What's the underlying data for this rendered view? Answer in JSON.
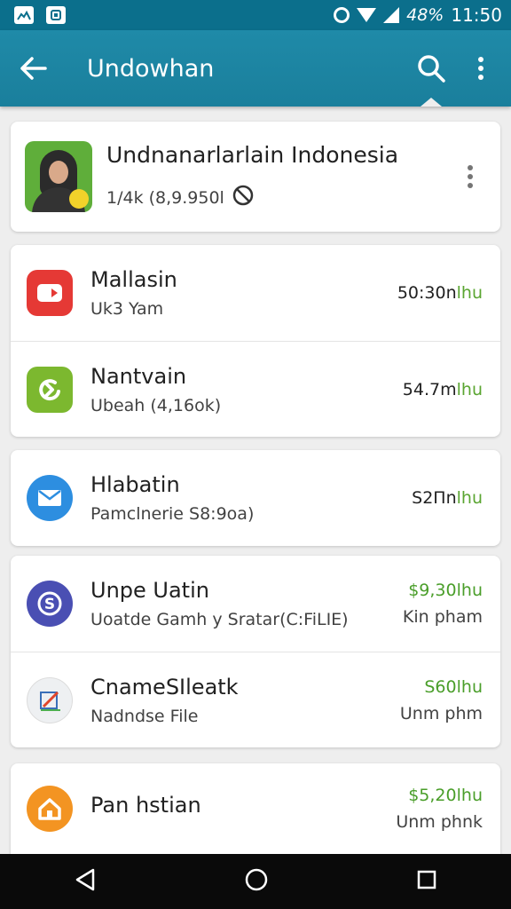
{
  "status_bar": {
    "battery_text": "48%",
    "time": "11:50",
    "icons": [
      "gallery-icon",
      "app-notification-icon",
      "alarm-icon",
      "wifi-icon",
      "signal-icon"
    ]
  },
  "app_bar": {
    "title": "Undowhan",
    "back_icon": "arrow-back-icon",
    "search_icon": "search-icon",
    "more_icon": "more-vert-icon",
    "color": "#1f8aa8"
  },
  "header_card": {
    "title": "Undnanarlarlain Indonesia",
    "stats": "1/4k  (8,9.950l",
    "stats_icon": "no-entry-icon"
  },
  "groups": [
    {
      "items": [
        {
          "name": "Mallasin",
          "subtitle": "Uk3 Yam",
          "price": "50:30n",
          "unit": "lhu",
          "icon": "video-icon",
          "icon_color": "#e53935"
        },
        {
          "name": "Nantvain",
          "subtitle": "Ubeah (4,16ok)",
          "price": "54.7m",
          "unit": "lhu",
          "icon": "refresh-arrow-icon",
          "icon_color": "#7cb82f"
        }
      ]
    },
    {
      "items": [
        {
          "name": "Hlabatin",
          "subtitle": "Pamclnerie S8:9oa)",
          "price": "S2Πn",
          "unit": "lhu",
          "icon": "mail-icon",
          "icon_color": "#2d8ee0"
        }
      ]
    },
    {
      "items": [
        {
          "name": "Unpe Uatin",
          "subtitle": "Uoatde Gamh y Sratar(C:FiLIE)",
          "price": "$9,30",
          "unit": "lhu",
          "extra": "Kin pham",
          "icon": "sync-s-icon",
          "icon_color": "#4a4fb3"
        },
        {
          "name": "CnameSIleatk",
          "subtitle": "Nadndse File",
          "price": "S60",
          "unit": "lhu",
          "extra": "Unm phm",
          "icon": "pencil-chart-icon",
          "icon_color": "#eef0f2"
        }
      ]
    },
    {
      "items": [
        {
          "name": "Pan hstian",
          "subtitle": "",
          "price": "$5,20",
          "unit": "lhu",
          "extra": "Unm phnk",
          "icon": "home-icon",
          "icon_color": "#f39422"
        }
      ]
    }
  ],
  "nav_bar": {
    "icons": [
      "back-triangle-icon",
      "home-circle-icon",
      "recents-square-icon"
    ]
  }
}
